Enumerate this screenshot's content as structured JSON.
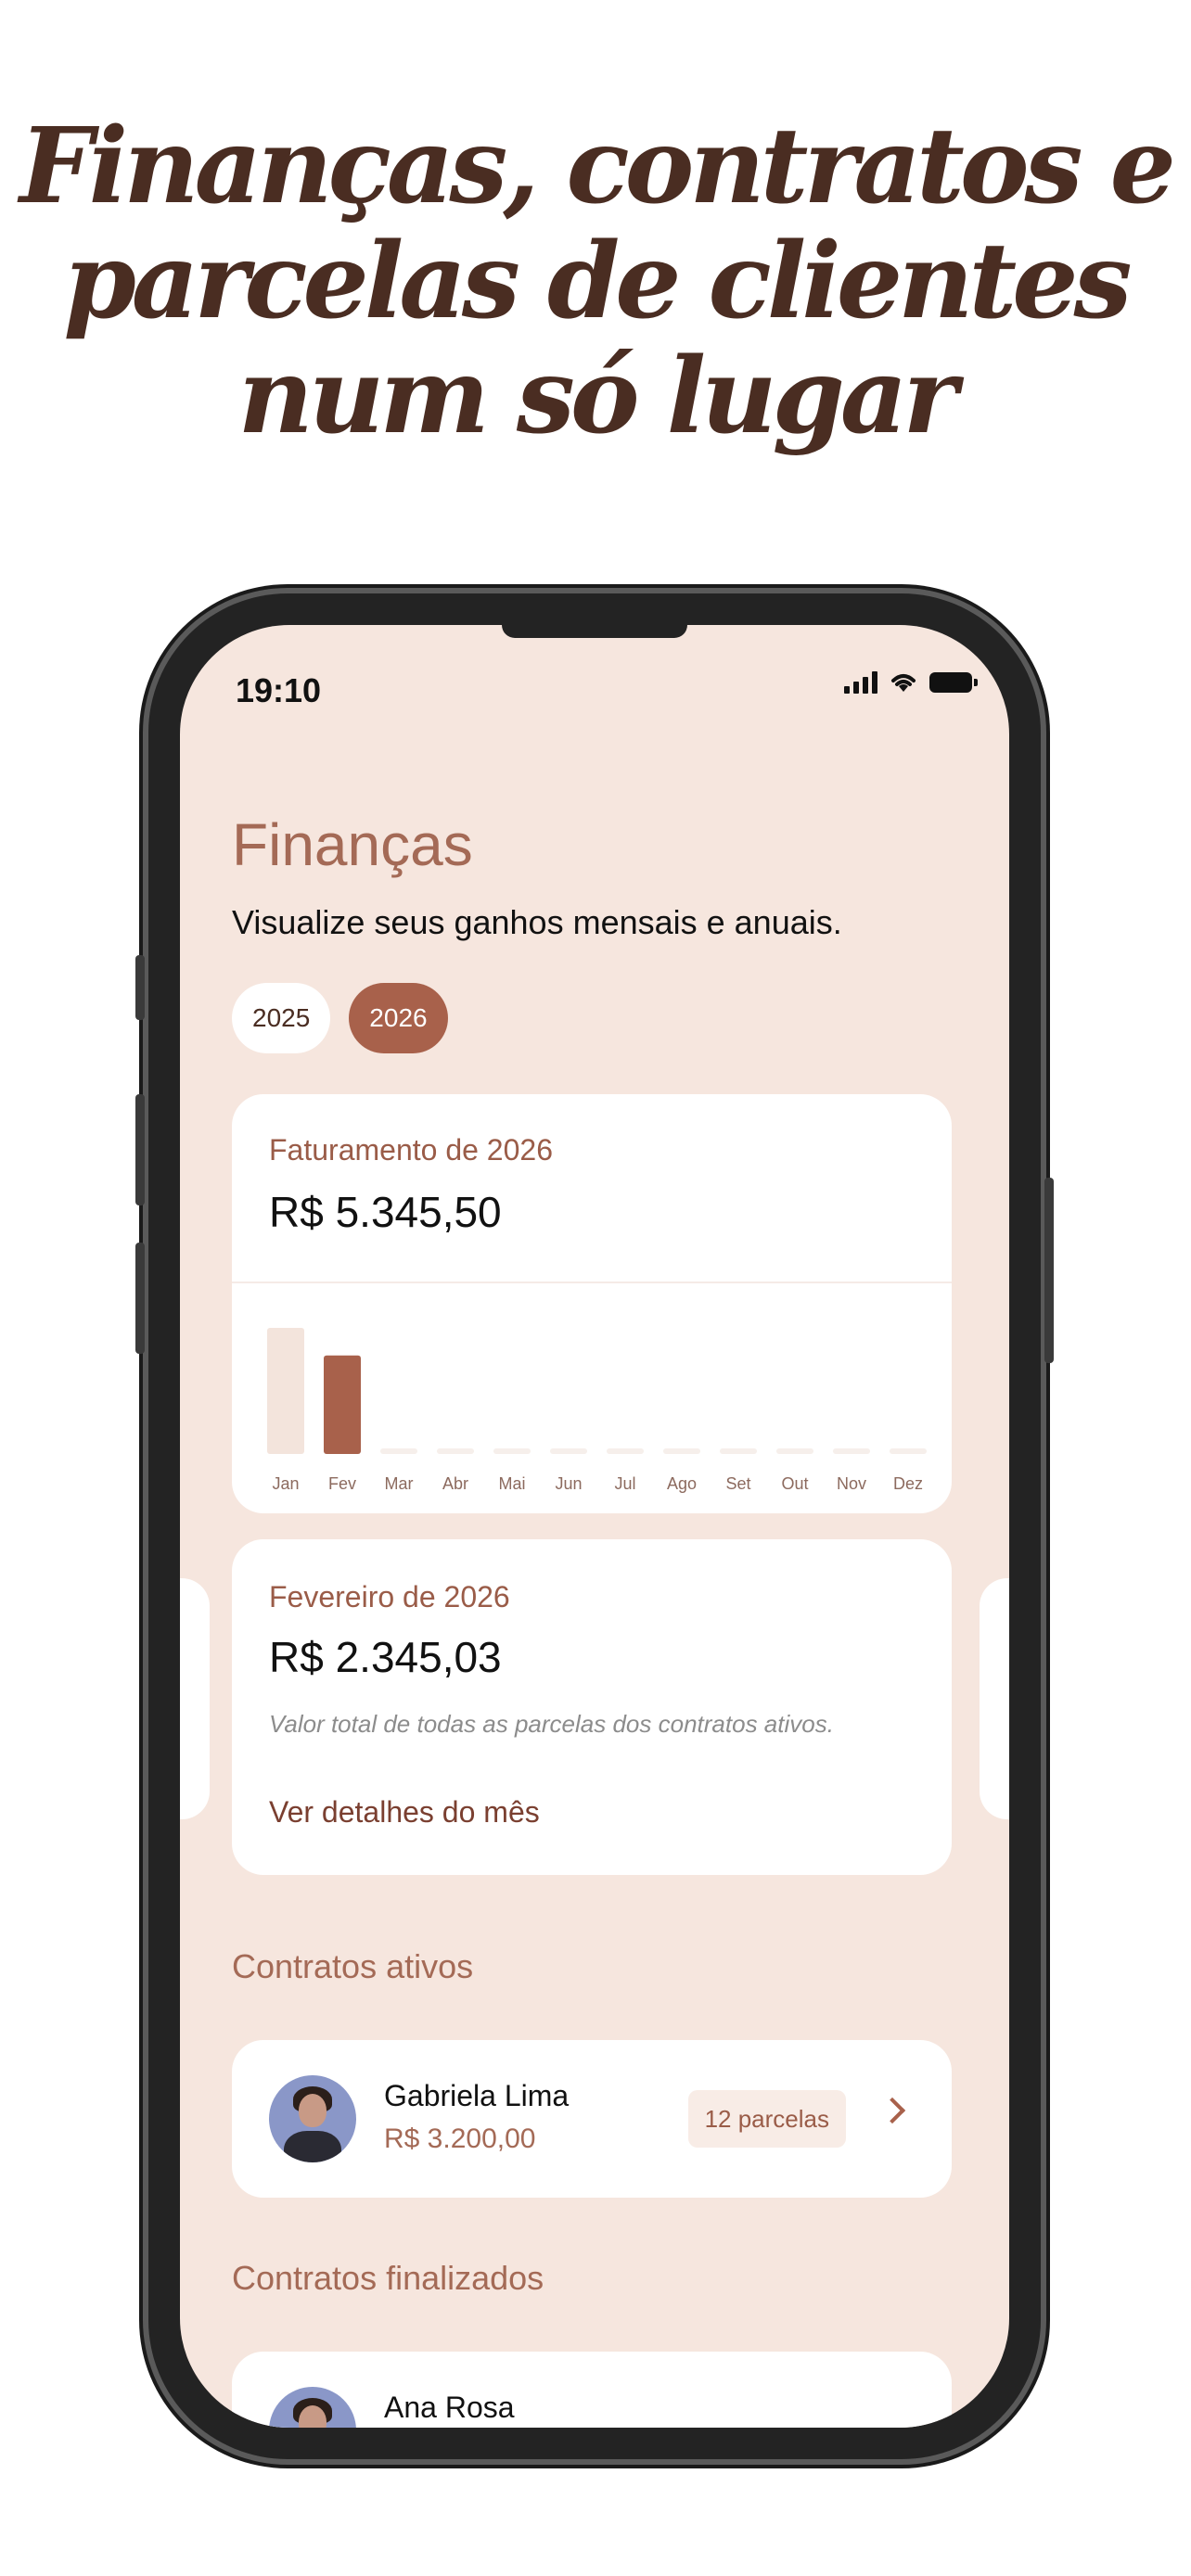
{
  "headline": {
    "line1": "Finanças, contratos e",
    "line2": "parcelas de clientes",
    "line3": "num só lugar"
  },
  "status_bar": {
    "time": "19:10",
    "icons": [
      "signal-icon",
      "wifi-icon",
      "battery-icon"
    ]
  },
  "page": {
    "title": "Finanças",
    "subtitle": "Visualize seus ganhos mensais e anuais."
  },
  "years": [
    {
      "label": "2025",
      "selected": false
    },
    {
      "label": "2026",
      "selected": true
    }
  ],
  "revenue_card": {
    "label": "Faturamento de 2026",
    "amount": "R$ 5.345,50"
  },
  "chart_data": {
    "type": "bar",
    "categories": [
      "Jan",
      "Fev",
      "Mar",
      "Abr",
      "Mai",
      "Jun",
      "Jul",
      "Ago",
      "Set",
      "Out",
      "Nov",
      "Dez"
    ],
    "values": [
      3000.47,
      2345.03,
      0,
      0,
      0,
      0,
      0,
      0,
      0,
      0,
      0,
      0
    ],
    "highlighted": "Fev",
    "colors": {
      "highlight": "#a8614b",
      "normal": "#f3e4dc",
      "empty": "#f6efeb"
    }
  },
  "month_card": {
    "label": "Fevereiro de 2026",
    "amount": "R$ 2.345,03",
    "note": "Valor total de todas as parcelas dos contratos ativos.",
    "link": "Ver detalhes do mês"
  },
  "active_contracts": {
    "title": "Contratos ativos",
    "items": [
      {
        "name": "Gabriela Lima",
        "value": "R$ 3.200,00",
        "badge": "12 parcelas"
      }
    ]
  },
  "finished_contracts": {
    "title": "Contratos finalizados",
    "items": [
      {
        "name": "Ana Rosa"
      }
    ]
  },
  "colors": {
    "accent": "#a8614b",
    "background": "#f6e6de",
    "title": "#a46a56"
  }
}
